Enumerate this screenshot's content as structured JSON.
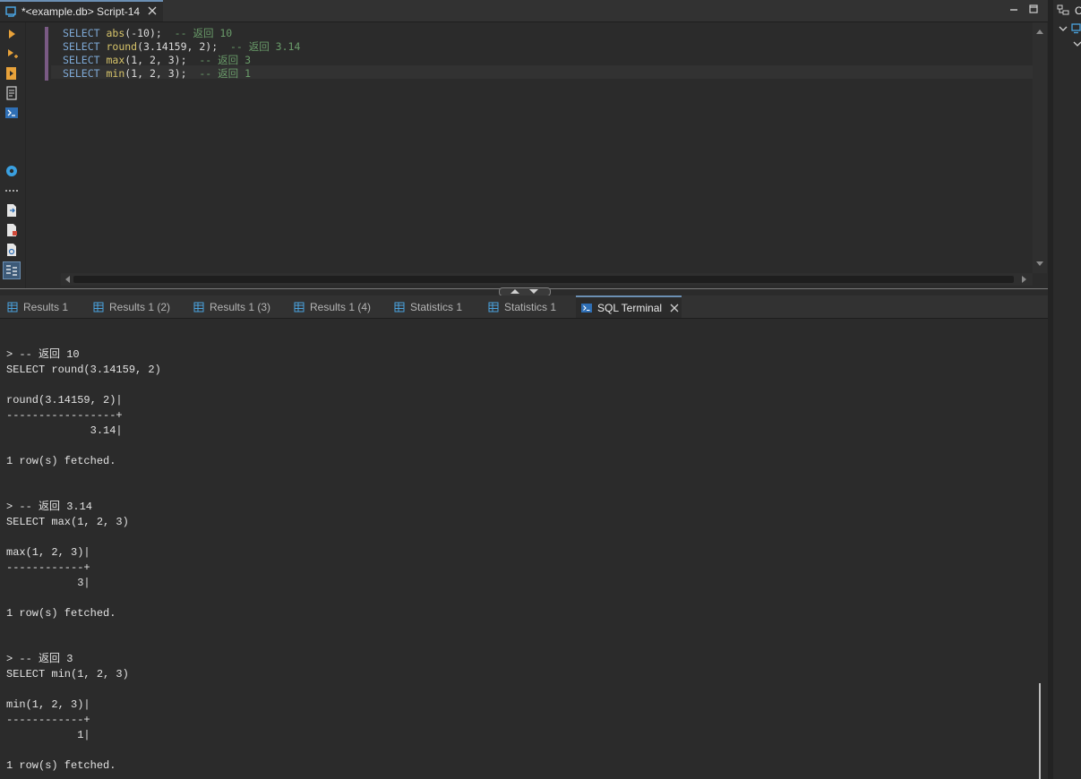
{
  "editor_tab": {
    "title": "*<example.db> Script-14",
    "icon": "sql-script-icon"
  },
  "window_controls": {
    "minimize": "minimize-icon",
    "maximize": "maximize-icon"
  },
  "left_toolbar": [
    "execute-statement-icon",
    "execute-in-new-tab-icon",
    "execute-script-icon",
    "explain-plan-icon",
    "open-terminal-icon",
    "settings-gear-icon",
    "more-dots-icon",
    "export-icon",
    "import-icon",
    "load-file-icon",
    "toggle-panels-icon"
  ],
  "editor": {
    "lines": [
      {
        "kw": "SELECT",
        "fn": "abs",
        "args": "(-10);",
        "comment": "-- 返回 10"
      },
      {
        "kw": "SELECT",
        "fn": "round",
        "args": "(3.14159, 2);",
        "comment": "-- 返回 3.14"
      },
      {
        "kw": "SELECT",
        "fn": "max",
        "args": "(1, 2, 3);",
        "comment": "-- 返回 3"
      },
      {
        "kw": "SELECT",
        "fn": "min",
        "args": "(1, 2, 3);",
        "comment": "-- 返回 1"
      }
    ]
  },
  "results_tabs": [
    {
      "label": "Results 1",
      "icon": "grid-icon",
      "active": false
    },
    {
      "label": "Results 1 (2)",
      "icon": "grid-icon",
      "active": false
    },
    {
      "label": "Results 1 (3)",
      "icon": "grid-icon",
      "active": false
    },
    {
      "label": "Results 1 (4)",
      "icon": "grid-icon",
      "active": false
    },
    {
      "label": "Statistics 1",
      "icon": "grid-icon",
      "active": false
    },
    {
      "label": "Statistics 1",
      "icon": "grid-icon",
      "active": false
    },
    {
      "label": "SQL Terminal",
      "icon": "terminal-icon",
      "active": true
    }
  ],
  "terminal": {
    "lines": [
      "> -- 返回 10",
      "SELECT round(3.14159, 2)",
      "",
      "round(3.14159, 2)|",
      "-----------------+",
      "             3.14|",
      "",
      "1 row(s) fetched.",
      "",
      "",
      "> -- 返回 3.14",
      "SELECT max(1, 2, 3)",
      "",
      "max(1, 2, 3)|",
      "------------+",
      "           3|",
      "",
      "1 row(s) fetched.",
      "",
      "",
      "> -- 返回 3",
      "SELECT min(1, 2, 3)",
      "",
      "min(1, 2, 3)|",
      "------------+",
      "           1|",
      "",
      "1 row(s) fetched."
    ]
  },
  "right_panel": {
    "title": "C"
  },
  "colors": {
    "background": "#2b2b2b",
    "keyword": "#7ea9d6",
    "function": "#d7c46a",
    "comment": "#6a9c6a",
    "active_tab_accent": "#6b8fb3"
  }
}
